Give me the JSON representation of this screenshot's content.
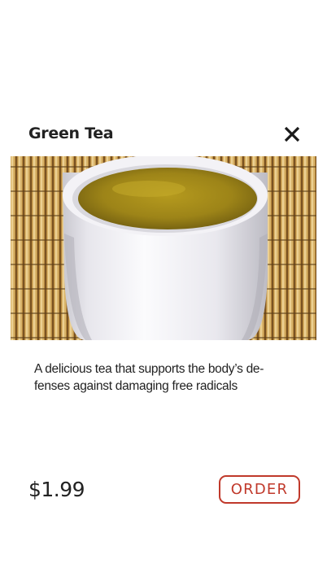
{
  "item": {
    "title": "Green Tea",
    "description": "A delicious tea that supports the body’s de-fenses against damaging free radicals",
    "price": "$1.99"
  },
  "actions": {
    "order_label": "ORDER",
    "close_icon": "close-icon"
  },
  "colors": {
    "accent": "#c0392b",
    "text": "#222222",
    "background": "#ffffff"
  }
}
